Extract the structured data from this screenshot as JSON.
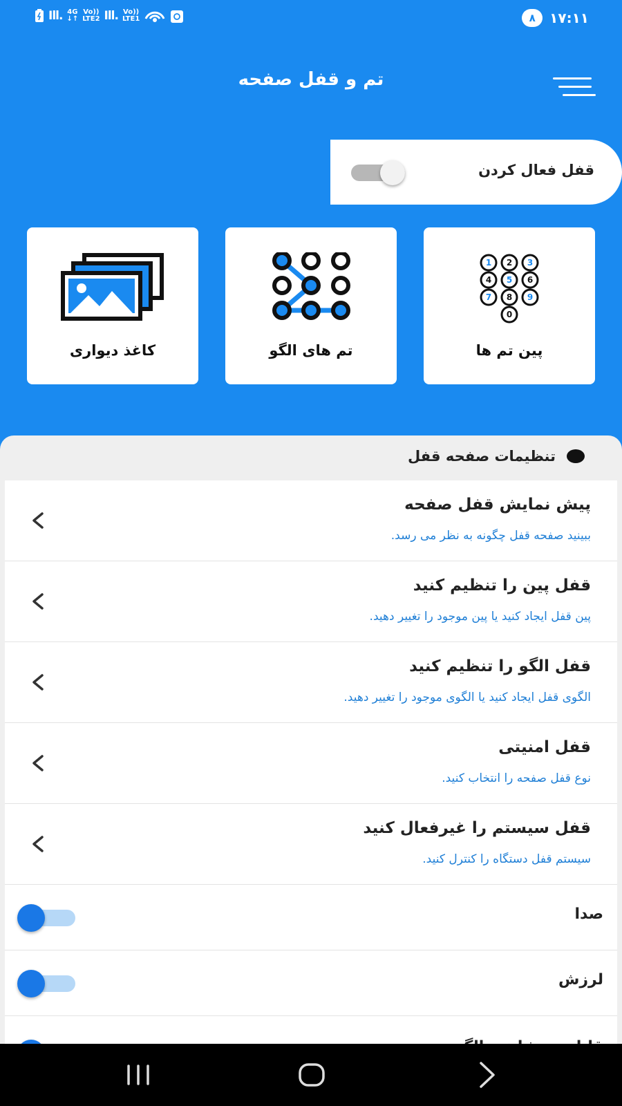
{
  "status_bar": {
    "network_1": "4G",
    "volte_1": "Vo))",
    "lte_1": "LTE2",
    "volte_2": "Vo))",
    "lte_2": "LTE1",
    "battery": "۸",
    "time": "۱۷:۱۱"
  },
  "header": {
    "title": "تم و قفل صفحه"
  },
  "lock_toggle": {
    "label": "قفل فعال کردن",
    "enabled": false
  },
  "feature_cards": [
    {
      "label": "پین تم ها",
      "icon": "pin-keypad-icon"
    },
    {
      "label": "تم های الگو",
      "icon": "pattern-grid-icon"
    },
    {
      "label": "کاغذ دیواری",
      "icon": "wallpaper-icon"
    }
  ],
  "settings": {
    "section_title": "تنظیمات صفحه قفل",
    "nav_items": [
      {
        "title": "پیش نمایش قفل صفحه",
        "subtitle": "ببینید صفحه قفل چگونه به نظر می رسد."
      },
      {
        "title": "قفل پین را تنظیم کنید",
        "subtitle": "پین قفل ایجاد کنید یا پین موجود را تغییر دهید."
      },
      {
        "title": "قفل الگو را تنظیم کنید",
        "subtitle": "الگوی قفل ایجاد کنید یا الگوی موجود را تغییر دهید."
      },
      {
        "title": "قفل امنیتی",
        "subtitle": "نوع قفل صفحه را انتخاب کنید."
      },
      {
        "title": "قفل سیستم را غیرفعال کنید",
        "subtitle": "سیستم قفل دستگاه را کنترل کنید."
      }
    ],
    "switch_items": [
      {
        "title": "صدا",
        "on": true
      },
      {
        "title": "لرزش",
        "on": true
      }
    ],
    "partial_item": {
      "title": "قابلیت مشاهده الگو"
    }
  },
  "colors": {
    "primary": "#1a8af0",
    "link_text": "#1f7fd6",
    "toggle_on": "#1a78e6"
  },
  "navbar": {
    "buttons": [
      "recent-apps-icon",
      "home-icon",
      "back-icon"
    ]
  }
}
